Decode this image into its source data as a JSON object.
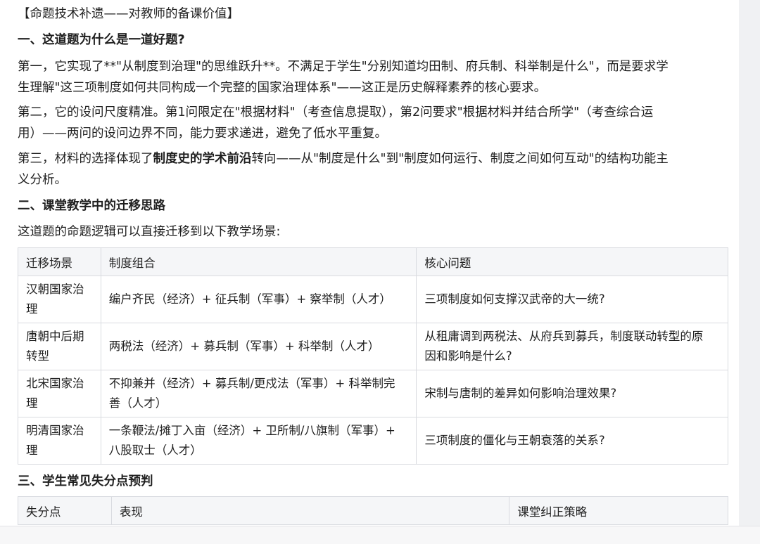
{
  "title": "【命题技术补遗——对教师的备课价值】",
  "section1": {
    "heading": "一、这道题为什么是一道好题?",
    "p1": [
      "第一，它实现了**\"从制度到治理\"的思维跃升**。不满足于学生\"分别知道均田制、府兵制、科举制是什么\"，而是要求学",
      "生理解\"这三项制度如何共同构成一个完整的国家治理体系\"——这正是历史解释素养的核心要求。"
    ],
    "p2": [
      "第二，它的设问尺度精准。第1问限定在\"根据材料\"（考查信息提取），第2问要求\"根据材料并结合所学\"（考查综合运",
      "用）——两问的设问边界不同，能力要求递进，避免了低水平重复。"
    ],
    "p3_pre": "第三，材料的选择体现了",
    "p3_bold": "制度史的学术前沿",
    "p3_post": "转向——从\"制度是什么\"到\"制度如何运行、制度之间如何互动\"的结构功能主",
    "p3_line2": "义分析。"
  },
  "section2": {
    "heading": "二、课堂教学中的迁移思路",
    "intro": "这道题的命题逻辑可以直接迁移到以下教学场景:",
    "table": {
      "headers": [
        "迁移场景",
        "制度组合",
        "核心问题"
      ],
      "rows": [
        {
          "scene": [
            "汉朝国家治",
            "理"
          ],
          "combo": [
            "编户齐民（经济）+ 征兵制（军事）+ 察举制（人才）"
          ],
          "question": [
            "三项制度如何支撑汉武帝的大一统?"
          ]
        },
        {
          "scene": [
            "唐朝中后期",
            "转型"
          ],
          "combo": [
            "两税法（经济）+ 募兵制（军事）+ 科举制（人才）"
          ],
          "question": [
            "从租庸调到两税法、从府兵到募兵，制度联动转型的原",
            "因和影响是什么?"
          ]
        },
        {
          "scene": [
            "北宋国家治",
            "理"
          ],
          "combo": [
            "不抑兼并（经济）+ 募兵制/更戍法（军事）+ 科举制完",
            "善（人才）"
          ],
          "question": [
            "宋制与唐制的差异如何影响治理效果?"
          ]
        },
        {
          "scene": [
            "明清国家治",
            "理"
          ],
          "combo": [
            "一条鞭法/摊丁入亩（经济）+ 卫所制/八旗制（军事）+",
            "八股取士（人才）"
          ],
          "question": [
            "三项制度的僵化与王朝衰落的关系?"
          ]
        }
      ]
    }
  },
  "section3": {
    "heading": "三、学生常见失分点预判",
    "table": {
      "headers": [
        "失分点",
        "表现",
        "课堂纠正策略"
      ]
    }
  }
}
